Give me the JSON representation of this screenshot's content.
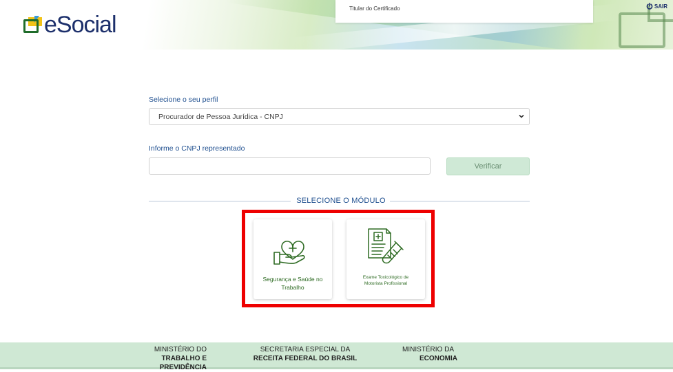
{
  "header": {
    "logo_text": "eSocial",
    "certificate_label": "Titular do Certificado",
    "logout_label": "SAIR",
    "colors": {
      "logo_green": "#1f6c2a",
      "logo_yellow": "#f2c318",
      "logo_blue": "#3a9ad6",
      "brand_navy": "#1c2f6b"
    }
  },
  "form": {
    "profile_label": "Selecione o seu perfil",
    "profile_selected": "Procurador de Pessoa Jurídica - CNPJ",
    "cnpj_label": "Informe o CNPJ representado",
    "cnpj_value": "",
    "verify_label": "Verificar"
  },
  "modules": {
    "title": "SELECIONE O MÓDULO",
    "items": [
      {
        "label_line1": "Segurança e Saúde no",
        "label_line2": "Trabalho",
        "icon": "heart-hand-icon"
      },
      {
        "label_line1": "Exame Toxicológico de",
        "label_line2": "Motorista Profissional",
        "icon": "medical-report-test-tube-icon"
      }
    ],
    "highlight_color": "#ee0000"
  },
  "footer": {
    "ministry1_line1": "MINISTÉRIO DO",
    "ministry1_line2": "TRABALHO E PREVIDÊNCIA",
    "secretariat_line1": "SECRETARIA ESPECIAL DA",
    "secretariat_line2": "RECEITA FEDERAL DO BRASIL",
    "ministry2_line1": "MINISTÉRIO DA",
    "ministry2_line2": "ECONOMIA"
  }
}
